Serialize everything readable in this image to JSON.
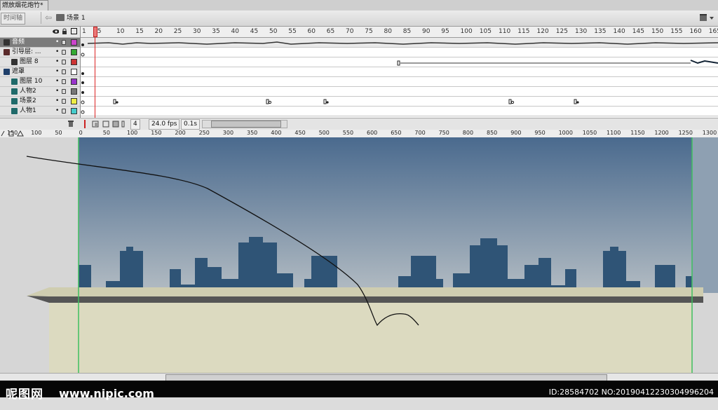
{
  "document": {
    "tab_title": "燃放烟花炮竹*"
  },
  "editbar": {
    "timeline_button": "时间轴",
    "back_arrow": "⇦",
    "scene_label": "场景 1"
  },
  "layers": [
    {
      "name": "音频",
      "selected": true,
      "swatch": "#cc44cc",
      "icon": "layer-icon"
    },
    {
      "name": "引导层: ...",
      "selected": false,
      "swatch": "#33aa33",
      "icon": "guide-layer-icon"
    },
    {
      "name": "图层 8",
      "selected": false,
      "swatch": "#cc3333",
      "icon": "layer-icon"
    },
    {
      "name": "遮罩",
      "selected": false,
      "swatch": "#ffffff",
      "icon": "mask-layer-icon"
    },
    {
      "name": "图层 10",
      "selected": false,
      "swatch": "#9933cc",
      "icon": "masked-layer-icon"
    },
    {
      "name": "人物2",
      "selected": false,
      "swatch": "#777777",
      "icon": "masked-layer-icon"
    },
    {
      "name": "场景2",
      "selected": false,
      "swatch": "#eeee44",
      "icon": "masked-layer-icon"
    },
    {
      "name": "人物1",
      "selected": false,
      "swatch": "#44cccc",
      "icon": "masked-layer-icon"
    }
  ],
  "frame_ruler": {
    "labels": [
      "1",
      "5",
      "10",
      "15",
      "20",
      "25",
      "30",
      "35",
      "40",
      "45",
      "50",
      "55",
      "60",
      "65",
      "70",
      "75",
      "80",
      "85",
      "90",
      "95",
      "100",
      "105",
      "110",
      "115",
      "120",
      "125",
      "130",
      "135",
      "140",
      "145",
      "150",
      "155",
      "160",
      "165"
    ]
  },
  "status": {
    "current_frame": "4",
    "fps": "24.0 fps",
    "elapsed": "0.1s"
  },
  "stage_ruler": {
    "labels": [
      "150",
      "100",
      "50",
      "0",
      "50",
      "100",
      "150",
      "200",
      "250",
      "300",
      "350",
      "400",
      "450",
      "500",
      "550",
      "600",
      "650",
      "700",
      "750",
      "800",
      "850",
      "900",
      "950",
      "1000",
      "1050",
      "1100",
      "1150",
      "1200",
      "1250",
      "1300"
    ]
  },
  "stage": {
    "sky_top": "#4a6a8e",
    "sky_bottom": "#b3bcc3",
    "building": "#2f5476",
    "ground": "#dcdac0",
    "ledge_top": "#cfcdb0",
    "ledge_shadow": "#555555"
  },
  "watermark": {
    "logo": "呢图网",
    "site": "www.nipic.com",
    "id": "ID:28584702 NO:20190412230304996204"
  }
}
